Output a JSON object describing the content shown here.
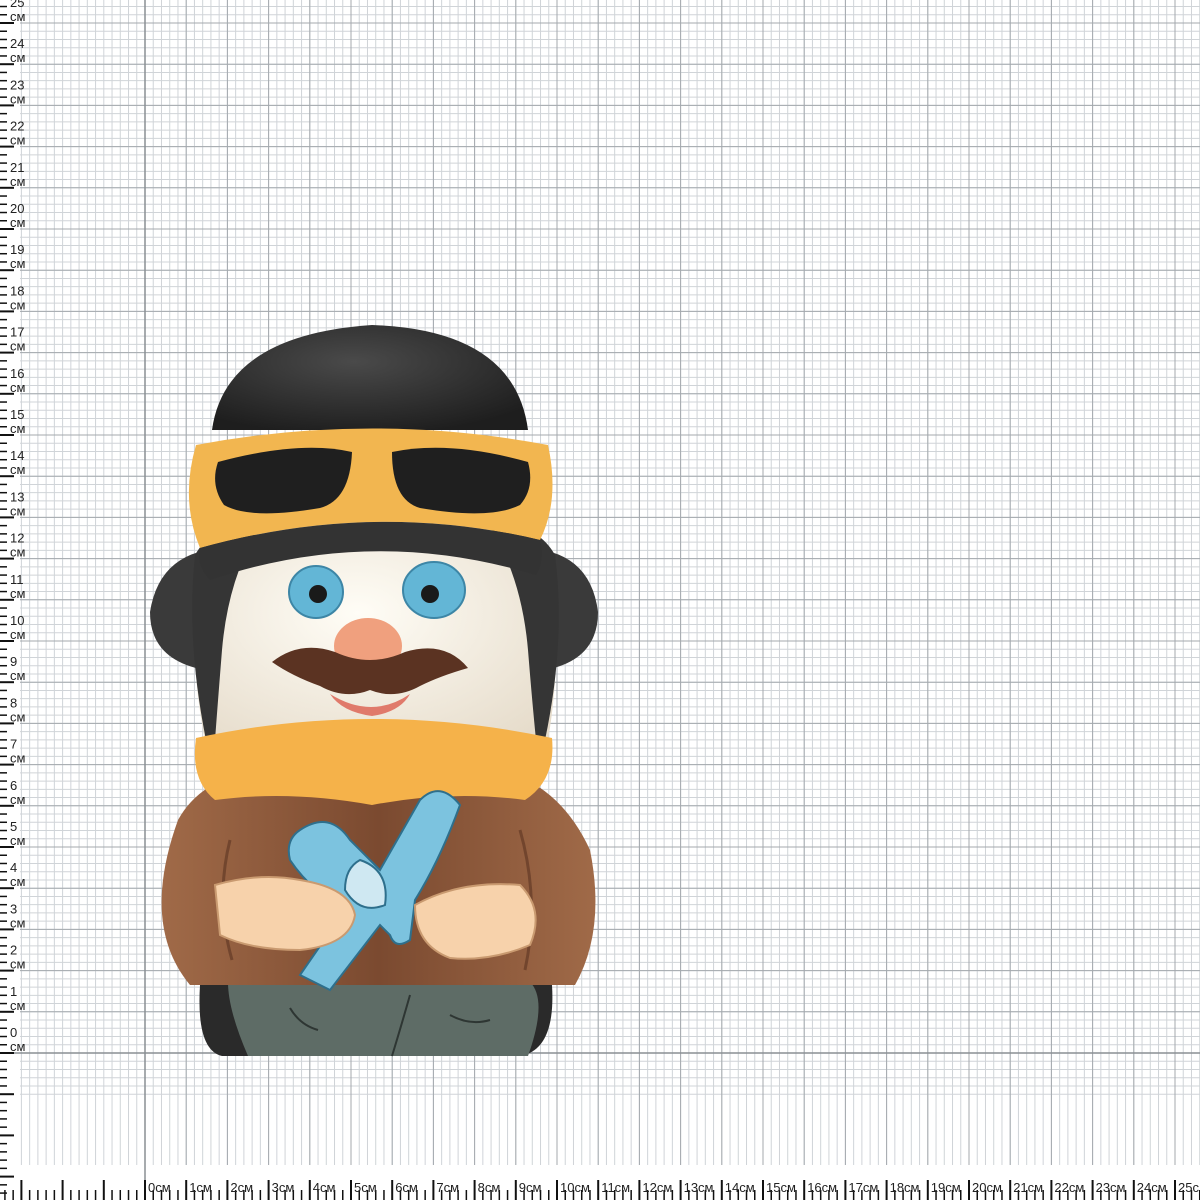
{
  "ruler": {
    "unit": "см",
    "vertical_labels": [
      "25",
      "24",
      "23",
      "22",
      "21",
      "20",
      "19",
      "18",
      "17",
      "16",
      "15",
      "14",
      "13",
      "12",
      "11",
      "10",
      "9",
      "8",
      "7",
      "6",
      "5",
      "4",
      "3",
      "2",
      "1",
      "0"
    ],
    "horizontal_labels": [
      "0см",
      "1см",
      "2см",
      "3см",
      "4см",
      "5см",
      "6см",
      "7см",
      "8см",
      "9см",
      "10см",
      "11см",
      "12см",
      "13см",
      "14см",
      "15см",
      "16см",
      "17см",
      "18см",
      "19см",
      "20см",
      "21см",
      "22см",
      "23см",
      "24см",
      "25с"
    ]
  },
  "figurine": {
    "subject": "ceramic aviator figurine holding a toy plane",
    "colors": {
      "helmet": "#2b2b2b",
      "goggle_band": "#f2b650",
      "face": "#f7f2e6",
      "eyes": "#63b6d6",
      "nose": "#f0a07e",
      "mustache": "#5b3322",
      "scarf": "#f5b24a",
      "jacket": "#8b5a3c",
      "hands": "#f7d2ab",
      "plane": "#7cc3df",
      "pants": "#5e6c66",
      "boots": "#2a2a2a"
    }
  },
  "colors": {
    "grid_minor": "#d0d4d8",
    "grid_major": "#a4a9ae",
    "axis": "#8a8f94",
    "tick": "#111111",
    "background": "#ffffff"
  }
}
